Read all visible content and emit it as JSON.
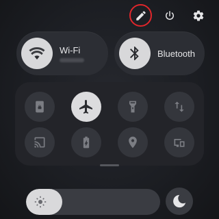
{
  "top_bar": {
    "edit_icon": "pencil-icon",
    "power_icon": "power-icon",
    "settings_icon": "gear-icon",
    "edit_highlight_color": "#e1262b"
  },
  "big_tiles": [
    {
      "label": "Wi-Fi",
      "icon": "wifi-icon",
      "active": true
    },
    {
      "label": "Bluetooth",
      "icon": "bluetooth-icon",
      "active": true
    }
  ],
  "quick_settings": [
    {
      "name": "screen-lock",
      "icon": "lock-screen-icon",
      "active": false
    },
    {
      "name": "airplane-mode",
      "icon": "airplane-icon",
      "active": true
    },
    {
      "name": "flashlight",
      "icon": "flashlight-icon",
      "active": false
    },
    {
      "name": "mobile-data",
      "icon": "data-arrows-icon",
      "active": false
    },
    {
      "name": "cast",
      "icon": "cast-icon",
      "active": false
    },
    {
      "name": "battery-saver",
      "icon": "battery-saver-icon",
      "active": false
    },
    {
      "name": "location",
      "icon": "location-pin-icon",
      "active": false
    },
    {
      "name": "screen-mirror",
      "icon": "screen-cast-icon",
      "active": false
    }
  ],
  "brightness": {
    "level": 0.27,
    "icon": "sun-icon"
  },
  "dark_mode": {
    "icon": "moon-icon",
    "active": false
  }
}
